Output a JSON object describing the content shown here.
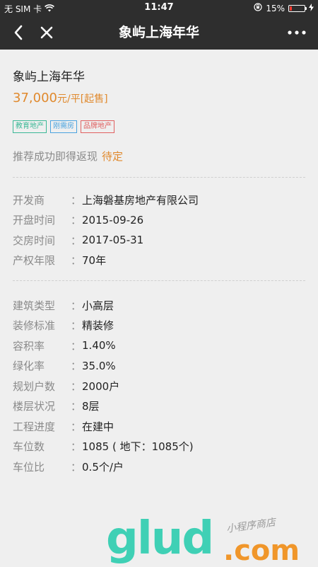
{
  "status_bar": {
    "carrier": "无 SIM 卡",
    "time": "11:47",
    "battery_percent": "15%",
    "battery_level": 0.15
  },
  "nav": {
    "title": "象屿上海年华",
    "back_icon": "chevron-left-icon",
    "close_icon": "close-icon",
    "more_icon": "more-dots-icon"
  },
  "property": {
    "name": "象屿上海年华",
    "price_amount": "37,000",
    "price_unit": "元/平[起售]",
    "tags": [
      {
        "label": "教育地产",
        "color": "#3bb896"
      },
      {
        "label": "刚需房",
        "color": "#4aa3df"
      },
      {
        "label": "品牌地产",
        "color": "#e06060"
      }
    ],
    "rebate_label": "推荐成功即得返现",
    "rebate_value": "待定"
  },
  "info_group_1": [
    {
      "label": "开发商",
      "value": "上海磐基房地产有限公司"
    },
    {
      "label": "开盘时间",
      "value": "2015-09-26"
    },
    {
      "label": "交房时间",
      "value": "2017-05-31"
    },
    {
      "label": "产权年限",
      "value": "70年"
    }
  ],
  "info_group_2": [
    {
      "label": "建筑类型",
      "value": "小高层"
    },
    {
      "label": "装修标准",
      "value": "精装修"
    },
    {
      "label": "容积率",
      "value": "1.40%"
    },
    {
      "label": "绿化率",
      "value": "35.0%"
    },
    {
      "label": "规划户数",
      "value": "2000户"
    },
    {
      "label": "楼层状况",
      "value": "8层"
    },
    {
      "label": "工程进度",
      "value": "在建中"
    },
    {
      "label": "车位数",
      "value": "1085 ( 地下：1085个)"
    },
    {
      "label": "车位比",
      "value": "0.5个/户"
    }
  ],
  "watermark": {
    "brand": "glud",
    "domain": ".com",
    "store": "小程序商店"
  }
}
